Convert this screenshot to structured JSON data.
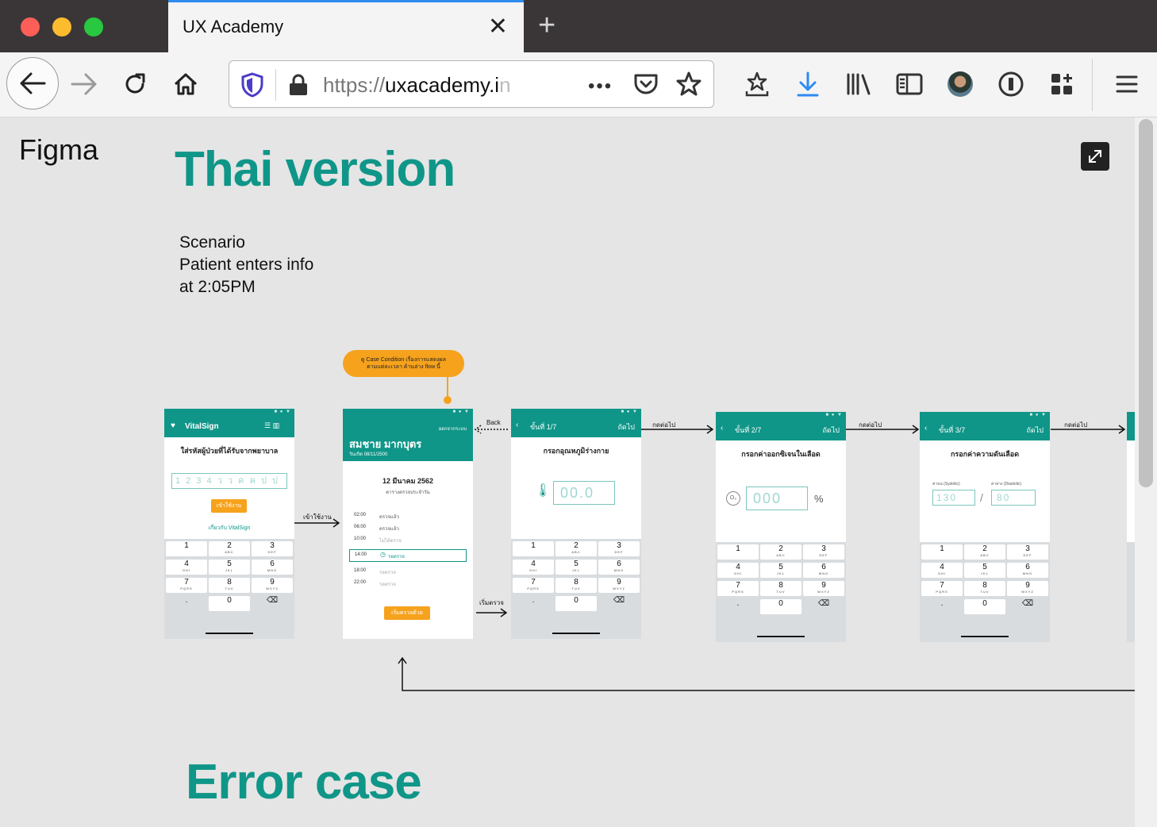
{
  "browser": {
    "tab_title": "UX Academy",
    "url": "https://uxacademy.in",
    "url_scheme": "https://",
    "url_host": "uxacademy.i",
    "url_fade": "n"
  },
  "page": {
    "app_name": "Figma",
    "heading_thai": "Thai version",
    "heading_error": "Error case",
    "scenario": [
      "Scenario",
      "Patient enters info",
      "at 2:05PM"
    ]
  },
  "tooltip": [
    "ดู Case Condition เรื่องการแสดงผล",
    "ตามแต่ละเวลา ด้านล่าง flow นี้"
  ],
  "flow_labels": {
    "login": "เข้าใช้งาน",
    "back": "Back",
    "start": "เริ่มตรวจ",
    "next": "กดต่อไป"
  },
  "screen_login": {
    "brand": "VitalSign",
    "prompt": "ใส่รหัสผู้ป่วยที่ได้รับจากพยาบาล",
    "placeholder": "1 2 3 4 ว ว ค ค ป ป",
    "button": "เข้าใช้งาน",
    "link": "เกี่ยวกับ VitalSign"
  },
  "screen_schedule": {
    "logout": "ออกจากระบบ",
    "name": "สมชาย มากบุตร",
    "dob": "วันเกิด 08/11/2500",
    "date": "12 มีนาคม 2562",
    "subtitle": "ตารางตรวจประจำวัน",
    "rows": [
      {
        "time": "02:00",
        "status": "ตรวจแล้ว"
      },
      {
        "time": "06:00",
        "status": "ตรวจแล้ว"
      },
      {
        "time": "10:00",
        "status": "ไม่ได้ตรวจ"
      },
      {
        "time": "14:00",
        "status": "รอตรวจ"
      },
      {
        "time": "18:00",
        "status": "รอตรวจ"
      },
      {
        "time": "22:00",
        "status": "รอตรวจ"
      }
    ],
    "button": "เริ่มตรวจด้วยตนเอง"
  },
  "screen_step1": {
    "step": "ขั้นที่ 1/7",
    "next": "ถัดไป",
    "title": "กรอกอุณหภูมิร่างกาย",
    "value": "00.0"
  },
  "screen_step2": {
    "step": "ขั้นที่ 2/7",
    "next": "ถัดไป",
    "title": "กรอกค่าออกซิเจนในเลือด",
    "value": "000",
    "unit": "%"
  },
  "screen_step3": {
    "step": "ขั้นที่ 3/7",
    "next": "ถัดไป",
    "title": "กรอกค่าความดันเลือด",
    "sys_label": "ค่าบน (Systolic)",
    "dia_label": "ค่าล่าง (Diastolic)",
    "sys_value": "130",
    "dia_value": "80",
    "slash": "/"
  },
  "keypad": {
    "keys": [
      "1",
      "2",
      "3",
      "4",
      "5",
      "6",
      "7",
      "8",
      "9",
      ".",
      "0",
      "⌫"
    ],
    "letters": [
      "",
      "ABC",
      "DEF",
      "GHI",
      "JKL",
      "MNO",
      "PQRS",
      "TUV",
      "WXYZ",
      "",
      "",
      ""
    ]
  },
  "colors": {
    "teal": "#0f9688",
    "orange": "#f6a21d",
    "accent_blue": "#2e8bf0"
  }
}
